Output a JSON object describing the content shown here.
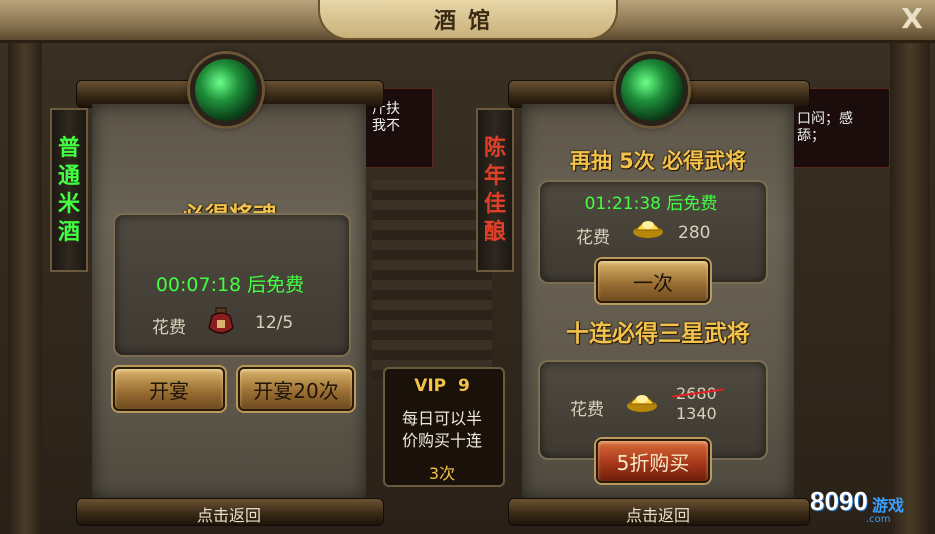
{
  "window": {
    "title": "酒馆",
    "close_label": "X"
  },
  "left_banner": {
    "chars": [
      "普",
      "通",
      "米",
      "酒"
    ]
  },
  "right_banner": {
    "chars": [
      "陈",
      "年",
      "佳",
      "酿"
    ]
  },
  "left_panel": {
    "heading": "必得将魂",
    "timer": "00:07:18 后免费",
    "cost_label": "花费",
    "cost_icon": "wine-jar-icon",
    "cost_value": "12/5",
    "btn_single": "开宴",
    "btn_twenty": "开宴20次",
    "footer": "点击返回"
  },
  "vip_box": {
    "title": "VIP  9",
    "line1": "每日可以半",
    "line2": "价购买十连",
    "count": "3次"
  },
  "right_panel": {
    "heading": "再抽 5次 必得武将",
    "timer": "01:21:38 后免费",
    "cost_label": "花费",
    "cost_icon": "gold-ingot-icon",
    "cost_value": "280",
    "btn_once": "一次",
    "ten_heading": "十连必得三星武将",
    "ten_cost_label": "花费",
    "ten_old_price": "2680",
    "ten_new_price": "1340",
    "btn_discount": "5折购买",
    "footer": "点击返回"
  },
  "side_notice_left": {
    "line1": "斤扶",
    "line2": "我不"
  },
  "side_notice_right": {
    "line1": "口闷；感",
    "line2": "舔；"
  },
  "watermark": {
    "digits": "8090",
    "sub": "游戏",
    "domain": ".com"
  },
  "colors": {
    "gold": "#f3c24a",
    "green": "#42ff42",
    "accent_red": "#a7381a"
  }
}
